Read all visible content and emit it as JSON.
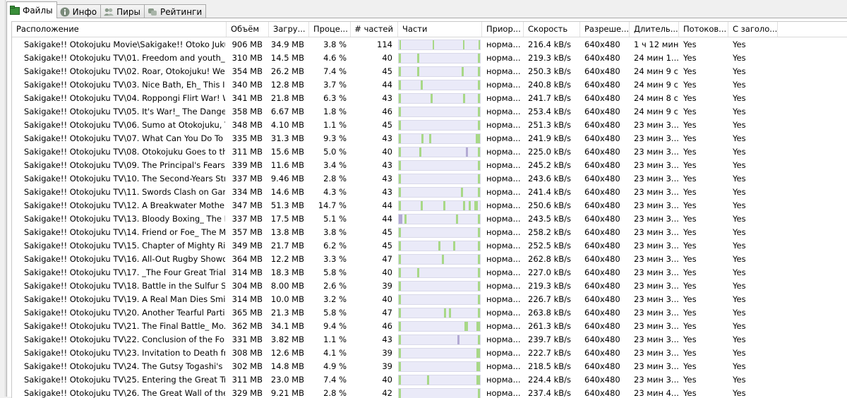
{
  "tabs": [
    {
      "label": "Файлы",
      "icon": "files-icon",
      "active": true
    },
    {
      "label": "Инфо",
      "icon": "info-icon",
      "active": false
    },
    {
      "label": "Пиры",
      "icon": "peers-icon",
      "active": false
    },
    {
      "label": "Рейтинги",
      "icon": "ratings-icon",
      "active": false
    }
  ],
  "columns": {
    "path": "Расположение",
    "size": "Объём",
    "downloaded": "Загру...",
    "percent": "Проце...",
    "pieces_count": "# частей",
    "pieces": "Части",
    "priority": "Приор...",
    "speed": "Скорость",
    "resolution": "Разреше...",
    "duration": "Длитель...",
    "streaming": "Потоков...",
    "header": "С заголо..."
  },
  "colors": {
    "piece_done": "#a8d887",
    "piece_other": "#b3aad4",
    "bar_bg": "#eaeaf8"
  },
  "files": [
    {
      "path": "Sakigake!! Otokojuku Movie\\Sakigake!! Otoko Juku...",
      "size": "906 MB",
      "downloaded": "34.9 MB",
      "percent": "3.8 %",
      "pieces_count": "114",
      "priority": "норма...",
      "speed": "216.4 kB/s",
      "resolution": "640x480",
      "duration": "1 ч 12 мин",
      "streaming": "Yes",
      "header": "Yes",
      "pieces": [
        {
          "start": 0.5,
          "w": 0.015,
          "kind": "done"
        },
        {
          "start": 48,
          "w": 0.01,
          "kind": "done"
        },
        {
          "start": 90,
          "w": 0.01,
          "kind": "done"
        },
        {
          "start": 113,
          "w": 0.015,
          "kind": "done"
        }
      ]
    },
    {
      "path": "Sakigake!! Otokojuku TV\\01. Freedom and youth_ ...",
      "size": "310 MB",
      "downloaded": "14.5 MB",
      "percent": "4.6 %",
      "pieces_count": "40",
      "priority": "норма...",
      "speed": "219.3 kB/s",
      "resolution": "640x480",
      "duration": "24 мин 1...",
      "streaming": "Yes",
      "header": "Yes",
      "pieces": [
        {
          "start": 0,
          "w": 0.03,
          "kind": "done"
        },
        {
          "start": 9,
          "w": 0.03,
          "kind": "done"
        },
        {
          "start": 39,
          "w": 0.03,
          "kind": "done"
        }
      ]
    },
    {
      "path": "Sakigake!! Otokojuku TV\\02. Roar, Otokojuku! We ...",
      "size": "354 MB",
      "downloaded": "26.2 MB",
      "percent": "7.4 %",
      "pieces_count": "45",
      "priority": "норма...",
      "speed": "250.3 kB/s",
      "resolution": "640x480",
      "duration": "24 мин 9 с",
      "streaming": "Yes",
      "header": "Yes",
      "pieces": [
        {
          "start": 0,
          "w": 0.03,
          "kind": "done"
        },
        {
          "start": 10,
          "w": 0.03,
          "kind": "done"
        },
        {
          "start": 35,
          "w": 0.03,
          "kind": "done"
        },
        {
          "start": 44,
          "w": 0.03,
          "kind": "done"
        }
      ]
    },
    {
      "path": "Sakigake!! Otokojuku TV\\03. Nice Bath, Eh_ This Is ...",
      "size": "340 MB",
      "downloaded": "12.8 MB",
      "percent": "3.7 %",
      "pieces_count": "44",
      "priority": "норма...",
      "speed": "240.8 kB/s",
      "resolution": "640x480",
      "duration": "24 мин 9 с",
      "streaming": "Yes",
      "header": "Yes",
      "pieces": [
        {
          "start": 0,
          "w": 0.03,
          "kind": "done"
        },
        {
          "start": 12,
          "w": 0.025,
          "kind": "done"
        },
        {
          "start": 43,
          "w": 0.03,
          "kind": "done"
        }
      ]
    },
    {
      "path": "Sakigake!! Otokojuku TV\\04. Roppongi Flirt War! W...",
      "size": "341 MB",
      "downloaded": "21.8 MB",
      "percent": "6.3 %",
      "pieces_count": "43",
      "priority": "норма...",
      "speed": "241.7 kB/s",
      "resolution": "640x480",
      "duration": "24 мин 8 с",
      "streaming": "Yes",
      "header": "Yes",
      "pieces": [
        {
          "start": 0,
          "w": 0.03,
          "kind": "done"
        },
        {
          "start": 17,
          "w": 0.025,
          "kind": "done"
        },
        {
          "start": 34,
          "w": 0.025,
          "kind": "done"
        },
        {
          "start": 42,
          "w": 0.03,
          "kind": "done"
        }
      ]
    },
    {
      "path": "Sakigake!! Otokojuku TV\\05. It's War!_ The Danger...",
      "size": "358 MB",
      "downloaded": "6.67 MB",
      "percent": "1.8 %",
      "pieces_count": "46",
      "priority": "норма...",
      "speed": "253.4 kB/s",
      "resolution": "640x480",
      "duration": "24 мин 9 с",
      "streaming": "Yes",
      "header": "Yes",
      "pieces": [
        {
          "start": 0,
          "w": 0.03,
          "kind": "done"
        },
        {
          "start": 45,
          "w": 0.03,
          "kind": "done"
        }
      ]
    },
    {
      "path": "Sakigake!! Otokojuku TV\\06. Sumo at Otokojuku, T...",
      "size": "348 MB",
      "downloaded": "4.10 MB",
      "percent": "1.1 %",
      "pieces_count": "45",
      "priority": "норма...",
      "speed": "251.3 kB/s",
      "resolution": "640x480",
      "duration": "23 мин 3...",
      "streaming": "Yes",
      "header": "Yes",
      "pieces": [
        {
          "start": 0,
          "w": 0.03,
          "kind": "done"
        },
        {
          "start": 44,
          "w": 0.03,
          "kind": "done"
        }
      ]
    },
    {
      "path": "Sakigake!! Otokojuku TV\\07. What Can You Do To ...",
      "size": "335 MB",
      "downloaded": "31.3 MB",
      "percent": "9.3 %",
      "pieces_count": "43",
      "priority": "норма...",
      "speed": "241.9 kB/s",
      "resolution": "640x480",
      "duration": "23 мин 3...",
      "streaming": "Yes",
      "header": "Yes",
      "pieces": [
        {
          "start": 0,
          "w": 0.03,
          "kind": "done"
        },
        {
          "start": 12,
          "w": 0.025,
          "kind": "done"
        },
        {
          "start": 16,
          "w": 0.025,
          "kind": "done"
        },
        {
          "start": 41,
          "w": 0.05,
          "kind": "done"
        }
      ]
    },
    {
      "path": "Sakigake!! Otokojuku TV\\08. Otokojuku Goes to th...",
      "size": "311 MB",
      "downloaded": "15.6 MB",
      "percent": "5.0 %",
      "pieces_count": "40",
      "priority": "норма...",
      "speed": "225.0 kB/s",
      "resolution": "640x480",
      "duration": "23 мин 3...",
      "streaming": "Yes",
      "header": "Yes",
      "pieces": [
        {
          "start": 0,
          "w": 0.03,
          "kind": "done"
        },
        {
          "start": 10,
          "w": 0.025,
          "kind": "done"
        },
        {
          "start": 33,
          "w": 0.025,
          "kind": "other"
        },
        {
          "start": 39,
          "w": 0.03,
          "kind": "done"
        }
      ]
    },
    {
      "path": "Sakigake!! Otokojuku TV\\09. The Principal's Fearso...",
      "size": "339 MB",
      "downloaded": "11.6 MB",
      "percent": "3.4 %",
      "pieces_count": "43",
      "priority": "норма...",
      "speed": "245.2 kB/s",
      "resolution": "640x480",
      "duration": "23 мин 3...",
      "streaming": "Yes",
      "header": "Yes",
      "pieces": [
        {
          "start": 0,
          "w": 0.03,
          "kind": "done"
        },
        {
          "start": 42,
          "w": 0.03,
          "kind": "done"
        }
      ]
    },
    {
      "path": "Sakigake!! Otokojuku TV\\10. The Second-Years Stri...",
      "size": "337 MB",
      "downloaded": "9.46 MB",
      "percent": "2.8 %",
      "pieces_count": "43",
      "priority": "норма...",
      "speed": "243.6 kB/s",
      "resolution": "640x480",
      "duration": "23 мин 3...",
      "streaming": "Yes",
      "header": "Yes",
      "pieces": [
        {
          "start": 0,
          "w": 0.03,
          "kind": "done"
        },
        {
          "start": 42,
          "w": 0.03,
          "kind": "done"
        }
      ]
    },
    {
      "path": "Sakigake!! Otokojuku TV\\11. Swords Clash on Ganr...",
      "size": "334 MB",
      "downloaded": "14.6 MB",
      "percent": "4.3 %",
      "pieces_count": "43",
      "priority": "норма...",
      "speed": "241.4 kB/s",
      "resolution": "640x480",
      "duration": "23 мин 3...",
      "streaming": "Yes",
      "header": "Yes",
      "pieces": [
        {
          "start": 0,
          "w": 0.03,
          "kind": "done"
        },
        {
          "start": 33,
          "w": 0.025,
          "kind": "done"
        },
        {
          "start": 42,
          "w": 0.03,
          "kind": "done"
        }
      ]
    },
    {
      "path": "Sakigake!! Otokojuku TV\\12. A Breakwater Mother ...",
      "size": "347 MB",
      "downloaded": "51.3 MB",
      "percent": "14.7 %",
      "pieces_count": "44",
      "priority": "норма...",
      "speed": "250.6 kB/s",
      "resolution": "640x480",
      "duration": "23 мин 3...",
      "streaming": "Yes",
      "header": "Yes",
      "pieces": [
        {
          "start": 0,
          "w": 0.03,
          "kind": "done"
        },
        {
          "start": 12,
          "w": 0.025,
          "kind": "done"
        },
        {
          "start": 24,
          "w": 0.025,
          "kind": "done"
        },
        {
          "start": 35,
          "w": 0.025,
          "kind": "done"
        },
        {
          "start": 38,
          "w": 0.03,
          "kind": "done"
        },
        {
          "start": 41,
          "w": 0.04,
          "kind": "done"
        }
      ]
    },
    {
      "path": "Sakigake!! Otokojuku TV\\13. Bloody Boxing_ The E...",
      "size": "337 MB",
      "downloaded": "17.5 MB",
      "percent": "5.1 %",
      "pieces_count": "44",
      "priority": "норма...",
      "speed": "243.5 kB/s",
      "resolution": "640x480",
      "duration": "23 мин 3...",
      "streaming": "Yes",
      "header": "Yes",
      "pieces": [
        {
          "start": 0,
          "w": 0.04,
          "kind": "other"
        },
        {
          "start": 3,
          "w": 0.025,
          "kind": "done"
        },
        {
          "start": 31,
          "w": 0.025,
          "kind": "done"
        },
        {
          "start": 43,
          "w": 0.03,
          "kind": "done"
        }
      ]
    },
    {
      "path": "Sakigake!! Otokojuku TV\\14. Friend or Foe_ The M...",
      "size": "357 MB",
      "downloaded": "13.8 MB",
      "percent": "3.8 %",
      "pieces_count": "45",
      "priority": "норма...",
      "speed": "258.2 kB/s",
      "resolution": "640x480",
      "duration": "23 мин 3...",
      "streaming": "Yes",
      "header": "Yes",
      "pieces": [
        {
          "start": 0,
          "w": 0.03,
          "kind": "done"
        },
        {
          "start": 44,
          "w": 0.03,
          "kind": "done"
        }
      ]
    },
    {
      "path": "Sakigake!! Otokojuku TV\\15. Chapter of Mighty Riv...",
      "size": "349 MB",
      "downloaded": "21.7 MB",
      "percent": "6.2 %",
      "pieces_count": "45",
      "priority": "норма...",
      "speed": "252.5 kB/s",
      "resolution": "640x480",
      "duration": "23 мин 3...",
      "streaming": "Yes",
      "header": "Yes",
      "pieces": [
        {
          "start": 0,
          "w": 0.03,
          "kind": "done"
        },
        {
          "start": 22,
          "w": 0.025,
          "kind": "done"
        },
        {
          "start": 30,
          "w": 0.025,
          "kind": "done"
        },
        {
          "start": 44,
          "w": 0.03,
          "kind": "done"
        }
      ]
    },
    {
      "path": "Sakigake!! Otokojuku TV\\16. All-Out Rugby Showd...",
      "size": "364 MB",
      "downloaded": "12.2 MB",
      "percent": "3.3 %",
      "pieces_count": "47",
      "priority": "норма...",
      "speed": "262.8 kB/s",
      "resolution": "640x480",
      "duration": "23 мин 3...",
      "streaming": "Yes",
      "header": "Yes",
      "pieces": [
        {
          "start": 0,
          "w": 0.03,
          "kind": "done"
        },
        {
          "start": 25,
          "w": 0.025,
          "kind": "done"
        },
        {
          "start": 46,
          "w": 0.03,
          "kind": "done"
        }
      ]
    },
    {
      "path": "Sakigake!! Otokojuku TV\\17. _The Four Great Trials...",
      "size": "314 MB",
      "downloaded": "18.3 MB",
      "percent": "5.8 %",
      "pieces_count": "40",
      "priority": "норма...",
      "speed": "227.0 kB/s",
      "resolution": "640x480",
      "duration": "23 мин 3...",
      "streaming": "Yes",
      "header": "Yes",
      "pieces": [
        {
          "start": 0,
          "w": 0.03,
          "kind": "done"
        },
        {
          "start": 9,
          "w": 0.025,
          "kind": "done"
        },
        {
          "start": 39,
          "w": 0.03,
          "kind": "done"
        }
      ]
    },
    {
      "path": "Sakigake!! Otokojuku TV\\18. Battle in the Sulfur Sp...",
      "size": "304 MB",
      "downloaded": "8.00 MB",
      "percent": "2.6 %",
      "pieces_count": "39",
      "priority": "норма...",
      "speed": "219.3 kB/s",
      "resolution": "640x480",
      "duration": "23 мин 3...",
      "streaming": "Yes",
      "header": "Yes",
      "pieces": [
        {
          "start": 0,
          "w": 0.03,
          "kind": "done"
        },
        {
          "start": 38,
          "w": 0.03,
          "kind": "done"
        }
      ]
    },
    {
      "path": "Sakigake!! Otokojuku TV\\19. A Real Man Dies Smili...",
      "size": "314 MB",
      "downloaded": "10.0 MB",
      "percent": "3.2 %",
      "pieces_count": "40",
      "priority": "норма...",
      "speed": "226.7 kB/s",
      "resolution": "640x480",
      "duration": "23 мин 3...",
      "streaming": "Yes",
      "header": "Yes",
      "pieces": [
        {
          "start": 0,
          "w": 0.03,
          "kind": "done"
        },
        {
          "start": 39,
          "w": 0.03,
          "kind": "done"
        }
      ]
    },
    {
      "path": "Sakigake!! Otokojuku TV\\20. Another Tearful Parti...",
      "size": "365 MB",
      "downloaded": "21.3 MB",
      "percent": "5.8 %",
      "pieces_count": "47",
      "priority": "норма...",
      "speed": "263.8 kB/s",
      "resolution": "640x480",
      "duration": "23 мин 3...",
      "streaming": "Yes",
      "header": "Yes",
      "pieces": [
        {
          "start": 0,
          "w": 0.03,
          "kind": "done"
        },
        {
          "start": 26,
          "w": 0.025,
          "kind": "done"
        },
        {
          "start": 29,
          "w": 0.025,
          "kind": "done"
        },
        {
          "start": 46,
          "w": 0.03,
          "kind": "done"
        }
      ]
    },
    {
      "path": "Sakigake!! Otokojuku TV\\21. The Final Battle_ Mo...",
      "size": "362 MB",
      "downloaded": "34.1 MB",
      "percent": "9.4 %",
      "pieces_count": "46",
      "priority": "норма...",
      "speed": "261.3 kB/s",
      "resolution": "640x480",
      "duration": "23 мин 3...",
      "streaming": "Yes",
      "header": "Yes",
      "pieces": [
        {
          "start": 0,
          "w": 0.03,
          "kind": "done"
        },
        {
          "start": 37,
          "w": 0.04,
          "kind": "done"
        },
        {
          "start": 44,
          "w": 0.025,
          "kind": "done"
        },
        {
          "start": 45,
          "w": 0.03,
          "kind": "done"
        }
      ]
    },
    {
      "path": "Sakigake!! Otokojuku TV\\22. Conclusion of the Fo...",
      "size": "331 MB",
      "downloaded": "3.82 MB",
      "percent": "1.1 %",
      "pieces_count": "43",
      "priority": "норма...",
      "speed": "239.7 kB/s",
      "resolution": "640x480",
      "duration": "23 мин 3...",
      "streaming": "Yes",
      "header": "Yes",
      "pieces": [
        {
          "start": 0,
          "w": 0.03,
          "kind": "done"
        },
        {
          "start": 31,
          "w": 0.025,
          "kind": "other"
        },
        {
          "start": 42,
          "w": 0.03,
          "kind": "done"
        }
      ]
    },
    {
      "path": "Sakigake!! Otokojuku TV\\23. Invitation to Death fro...",
      "size": "308 MB",
      "downloaded": "12.6 MB",
      "percent": "4.1 %",
      "pieces_count": "39",
      "priority": "норма...",
      "speed": "222.7 kB/s",
      "resolution": "640x480",
      "duration": "23 мин 3...",
      "streaming": "Yes",
      "header": "Yes",
      "pieces": [
        {
          "start": 0,
          "w": 0.03,
          "kind": "done"
        },
        {
          "start": 38,
          "w": 0.04,
          "kind": "done"
        }
      ]
    },
    {
      "path": "Sakigake!! Otokojuku TV\\24. The Gutsy Togashi's T...",
      "size": "302 MB",
      "downloaded": "14.8 MB",
      "percent": "4.9 %",
      "pieces_count": "39",
      "priority": "норма...",
      "speed": "218.5 kB/s",
      "resolution": "640x480",
      "duration": "23 мин 3...",
      "streaming": "Yes",
      "header": "Yes",
      "pieces": [
        {
          "start": 0,
          "w": 0.03,
          "kind": "done"
        },
        {
          "start": 38,
          "w": 0.045,
          "kind": "done"
        }
      ]
    },
    {
      "path": "Sakigake!! Otokojuku TV\\25. Entering the Great Tre...",
      "size": "311 MB",
      "downloaded": "23.0 MB",
      "percent": "7.4 %",
      "pieces_count": "40",
      "priority": "норма...",
      "speed": "224.4 kB/s",
      "resolution": "640x480",
      "duration": "23 мин 3...",
      "streaming": "Yes",
      "header": "Yes",
      "pieces": [
        {
          "start": 0,
          "w": 0.03,
          "kind": "done"
        },
        {
          "start": 14,
          "w": 0.025,
          "kind": "done"
        },
        {
          "start": 39,
          "w": 0.045,
          "kind": "done"
        }
      ]
    },
    {
      "path": "Sakigake!! Otokojuku TV\\26. The Great Wall of the ...",
      "size": "329 MB",
      "downloaded": "9.21 MB",
      "percent": "2.8 %",
      "pieces_count": "42",
      "priority": "норма...",
      "speed": "237.4 kB/s",
      "resolution": "640x480",
      "duration": "23 мин 4...",
      "streaming": "Yes",
      "header": "Yes",
      "pieces": [
        {
          "start": 0,
          "w": 0.03,
          "kind": "done"
        },
        {
          "start": 41,
          "w": 0.03,
          "kind": "done"
        }
      ]
    }
  ]
}
